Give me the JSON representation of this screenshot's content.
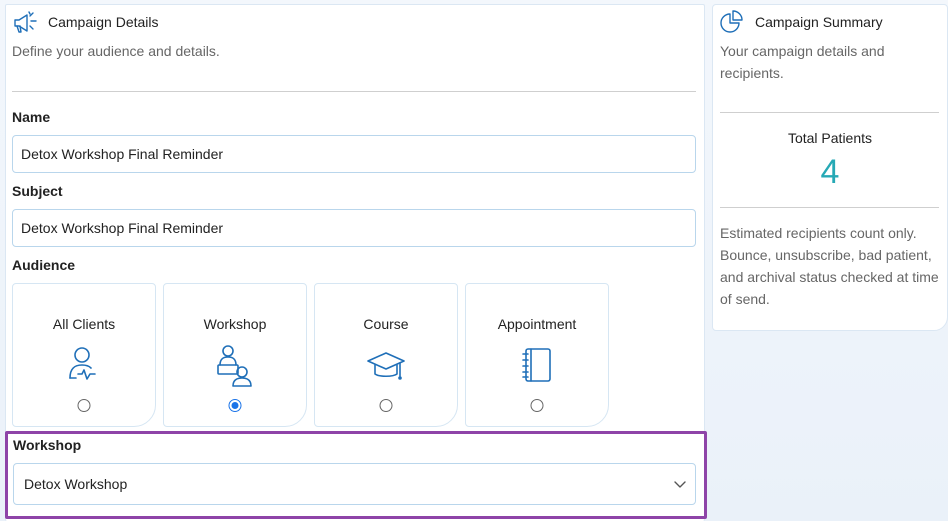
{
  "details": {
    "title": "Campaign Details",
    "subtitle": "Define your audience and details.",
    "name_label": "Name",
    "name_value": "Detox Workshop Final Reminder",
    "subject_label": "Subject",
    "subject_value": "Detox Workshop Final Reminder",
    "audience_label": "Audience",
    "audience_options": [
      {
        "label": "All Clients",
        "icon": "client-health-icon",
        "selected": false
      },
      {
        "label": "Workshop",
        "icon": "workshop-people-icon",
        "selected": true
      },
      {
        "label": "Course",
        "icon": "graduation-cap-icon",
        "selected": false
      },
      {
        "label": "Appointment",
        "icon": "notebook-icon",
        "selected": false
      }
    ],
    "workshop_label": "Workshop",
    "workshop_selected": "Detox Workshop"
  },
  "summary": {
    "title": "Campaign Summary",
    "subtitle": "Your campaign details and recipients.",
    "total_label": "Total Patients",
    "total_value": "4",
    "note": "Estimated recipients count only. Bounce, unsubscribe, bad patient, and archival status checked at time of send."
  },
  "colors": {
    "accent": "#1a73e8",
    "icon_blue": "#1f6fb8",
    "total_teal": "#26a9b5",
    "highlight_purple": "#8e44a8"
  }
}
